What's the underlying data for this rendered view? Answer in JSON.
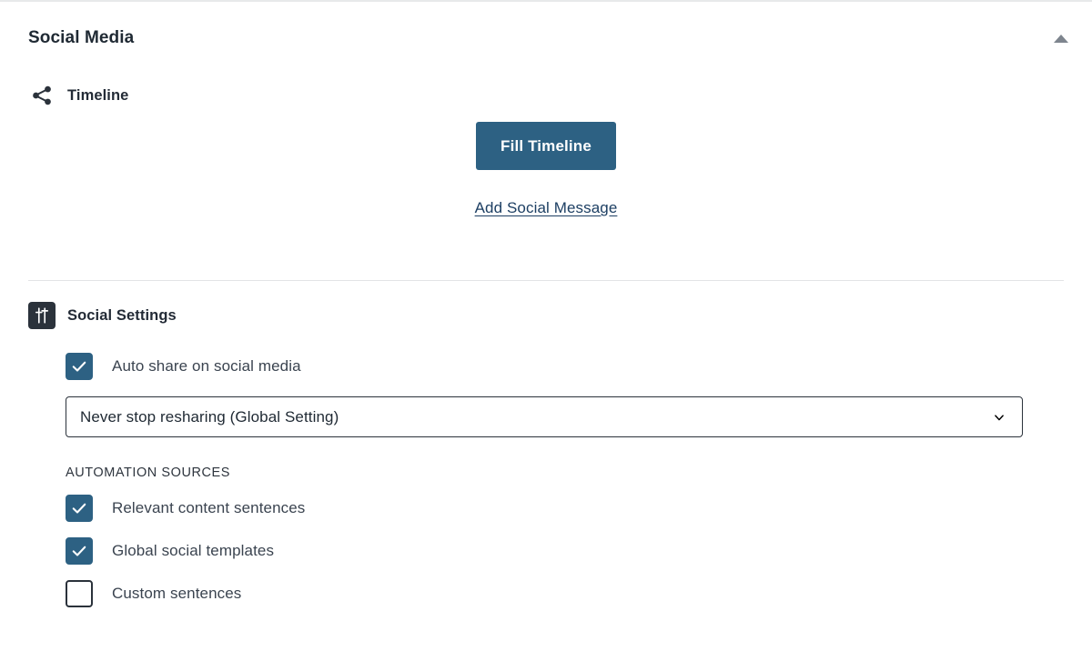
{
  "panel": {
    "title": "Social Media",
    "collapse_icon": "caret-up-icon"
  },
  "timeline": {
    "icon": "share-icon",
    "heading": "Timeline",
    "fill_button_label": "Fill Timeline",
    "add_message_link": "Add Social Message"
  },
  "social_settings": {
    "icon": "sliders-icon",
    "heading": "Social Settings",
    "auto_share": {
      "label": "Auto share on social media",
      "checked": true
    },
    "reshare_select": {
      "value": "Never stop resharing (Global Setting)",
      "caret_icon": "chevron-down-icon"
    },
    "automation_sources_label": "Automation Sources",
    "automation_sources": [
      {
        "label": "Relevant content sentences",
        "checked": true
      },
      {
        "label": "Global social templates",
        "checked": true
      },
      {
        "label": "Custom sentences",
        "checked": false
      }
    ]
  },
  "colors": {
    "accent": "#2d6183",
    "link": "#1d3f63",
    "text": "#212b36",
    "icon_dark": "#2b323b",
    "divider": "#e3e4e6",
    "caret_gray": "#7e858e"
  }
}
